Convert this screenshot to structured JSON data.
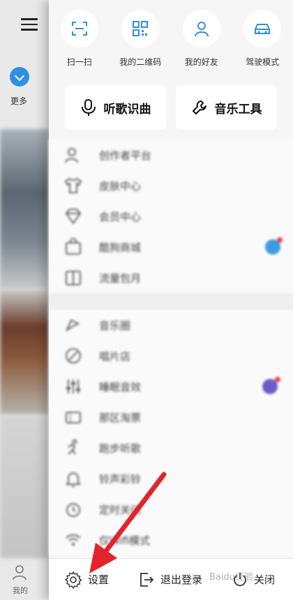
{
  "left_panel": {
    "more_label": "更多",
    "my_label": "我的"
  },
  "quick_actions": [
    {
      "label": "扫一扫",
      "icon": "scan-icon"
    },
    {
      "label": "我的二维码",
      "icon": "qr-code-icon"
    },
    {
      "label": "我的好友",
      "icon": "friend-icon"
    },
    {
      "label": "驾驶模式",
      "icon": "car-icon"
    }
  ],
  "cards": [
    {
      "label": "听歌识曲",
      "icon": "mic-icon"
    },
    {
      "label": "音乐工具",
      "icon": "wrench-icon"
    }
  ],
  "menu_group_1": [
    {
      "label": "创作者平台",
      "value": "",
      "icon": "user-icon"
    },
    {
      "label": "皮肤中心",
      "value": "",
      "icon": "shirt-icon"
    },
    {
      "label": "会员中心",
      "value": "",
      "icon": "diamond-icon"
    },
    {
      "label": "酷狗商城",
      "value": "",
      "icon": "shop-icon"
    },
    {
      "label": "流量包月",
      "value": "",
      "icon": "data-plan-icon"
    }
  ],
  "menu_group_2": [
    {
      "label": "音乐圈",
      "value": "",
      "icon": "music-circle-icon"
    },
    {
      "label": "唱片店",
      "value": "",
      "icon": "disc-icon"
    },
    {
      "label": "睡眠音效",
      "value": "",
      "icon": "sliders-icon"
    },
    {
      "label": "那区淘票",
      "value": "",
      "icon": "ticket-icon"
    },
    {
      "label": "跑步听歌",
      "value": "",
      "icon": "run-icon"
    },
    {
      "label": "铃声彩铃",
      "value": "",
      "icon": "bell-icon"
    },
    {
      "label": "定时关闭",
      "value": "",
      "icon": "timer-icon"
    },
    {
      "label": "仅Wifi模式",
      "value": "",
      "icon": "wifi-icon"
    }
  ],
  "bottom_bar": {
    "settings_label": "设置",
    "logout_label": "退出登录",
    "close_label": "关闭"
  },
  "watermark": "Baidu经验",
  "colors": {
    "accent_blue": "#2f8fe0",
    "arrow_red": "#e3242b",
    "drawer_bg": "#f6f6f6"
  }
}
